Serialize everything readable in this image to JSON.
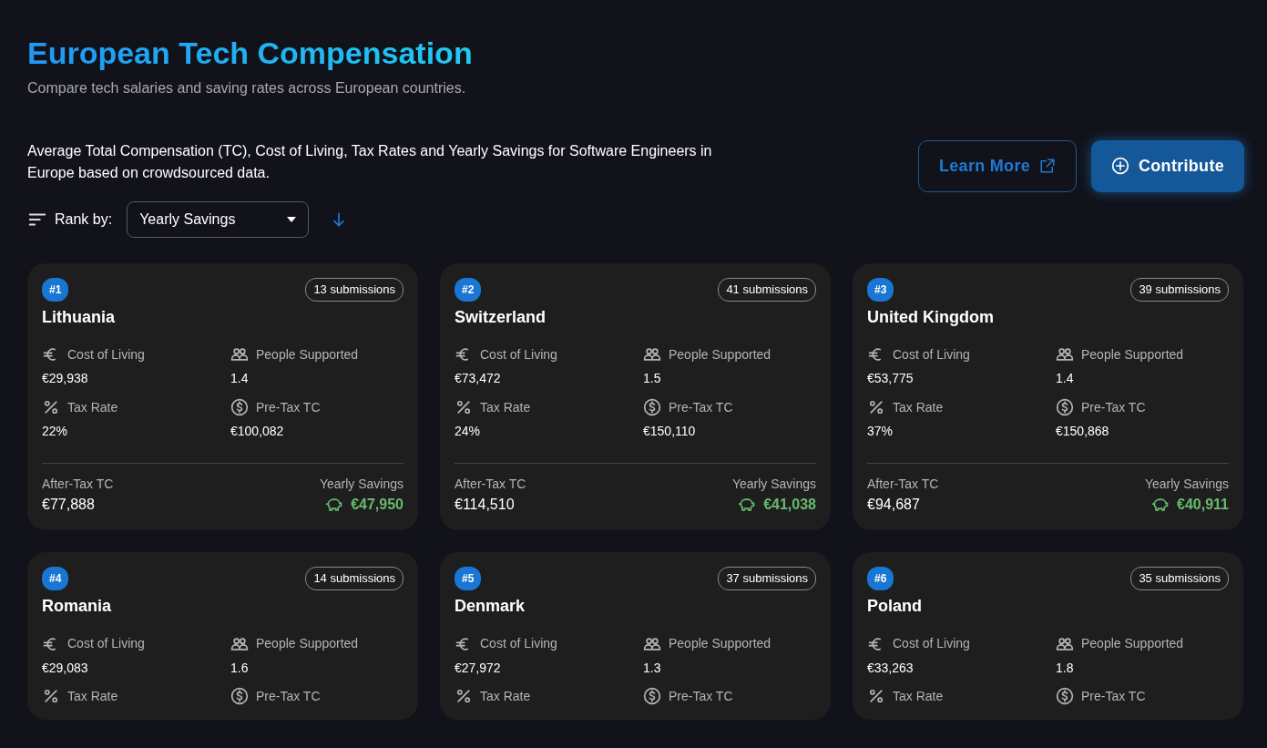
{
  "header": {
    "title": "European Tech Compensation",
    "subtitle": "Compare tech salaries and saving rates across European countries."
  },
  "description": "Average Total Compensation (TC), Cost of Living, Tax Rates and Yearly Savings for Software Engineers in Europe based on crowdsourced data.",
  "buttons": [
    {
      "kind": "outline",
      "label": "Learn More"
    },
    {
      "kind": "primary",
      "label": "Contribute"
    }
  ],
  "rank": {
    "label": "Rank by:",
    "value": "Yearly Savings",
    "descending": true
  },
  "cards": [
    {
      "rank": "#1",
      "submissions": "13 submissions",
      "country": "Lithuania",
      "stats": [
        {
          "kind": "cost",
          "label": "Cost of Living",
          "value": "€29,938"
        },
        {
          "kind": "people",
          "label": "People Supported",
          "value": "1.4"
        },
        {
          "kind": "tax",
          "label": "Tax Rate",
          "value": "22%"
        },
        {
          "kind": "pretax",
          "label": "Pre-Tax TC",
          "value": "€100,082"
        }
      ],
      "after_tax": {
        "label": "After-Tax TC",
        "value": "€77,888"
      },
      "savings": {
        "label": "Yearly Savings",
        "value": "€47,950"
      }
    },
    {
      "rank": "#2",
      "submissions": "41 submissions",
      "country": "Switzerland",
      "stats": [
        {
          "kind": "cost",
          "label": "Cost of Living",
          "value": "€73,472"
        },
        {
          "kind": "people",
          "label": "People Supported",
          "value": "1.5"
        },
        {
          "kind": "tax",
          "label": "Tax Rate",
          "value": "24%"
        },
        {
          "kind": "pretax",
          "label": "Pre-Tax TC",
          "value": "€150,110"
        }
      ],
      "after_tax": {
        "label": "After-Tax TC",
        "value": "€114,510"
      },
      "savings": {
        "label": "Yearly Savings",
        "value": "€41,038"
      }
    },
    {
      "rank": "#3",
      "submissions": "39 submissions",
      "country": "United Kingdom",
      "stats": [
        {
          "kind": "cost",
          "label": "Cost of Living",
          "value": "€53,775"
        },
        {
          "kind": "people",
          "label": "People Supported",
          "value": "1.4"
        },
        {
          "kind": "tax",
          "label": "Tax Rate",
          "value": "37%"
        },
        {
          "kind": "pretax",
          "label": "Pre-Tax TC",
          "value": "€150,868"
        }
      ],
      "after_tax": {
        "label": "After-Tax TC",
        "value": "€94,687"
      },
      "savings": {
        "label": "Yearly Savings",
        "value": "€40,911"
      }
    },
    {
      "rank": "#4",
      "submissions": "14 submissions",
      "country": "Romania",
      "stats": [
        {
          "kind": "cost",
          "label": "Cost of Living",
          "value": "€29,083"
        },
        {
          "kind": "people",
          "label": "People Supported",
          "value": "1.6"
        },
        {
          "kind": "tax",
          "label": "Tax Rate"
        },
        {
          "kind": "pretax",
          "label": "Pre-Tax TC"
        }
      ]
    },
    {
      "rank": "#5",
      "submissions": "37 submissions",
      "country": "Denmark",
      "stats": [
        {
          "kind": "cost",
          "label": "Cost of Living",
          "value": "€27,972"
        },
        {
          "kind": "people",
          "label": "People Supported",
          "value": "1.3"
        },
        {
          "kind": "tax",
          "label": "Tax Rate"
        },
        {
          "kind": "pretax",
          "label": "Pre-Tax TC"
        }
      ]
    },
    {
      "rank": "#6",
      "submissions": "35 submissions",
      "country": "Poland",
      "stats": [
        {
          "kind": "cost",
          "label": "Cost of Living",
          "value": "€33,263"
        },
        {
          "kind": "people",
          "label": "People Supported",
          "value": "1.8"
        },
        {
          "kind": "tax",
          "label": "Tax Rate"
        },
        {
          "kind": "pretax",
          "label": "Pre-Tax TC"
        }
      ]
    }
  ]
}
